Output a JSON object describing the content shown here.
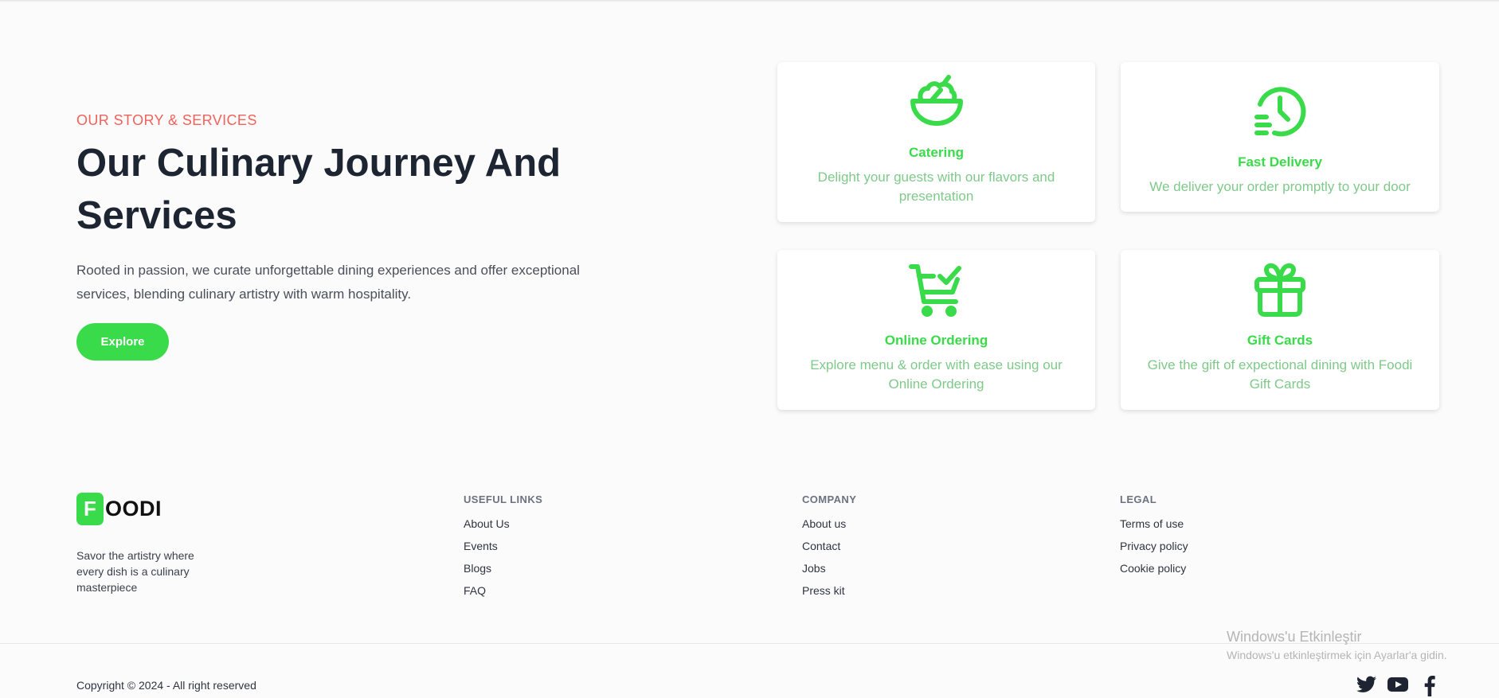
{
  "hero": {
    "eyebrow": "OUR STORY & SERVICES",
    "title": "Our Culinary Journey And Services",
    "description": "Rooted in passion, we curate unforgettable dining experiences and offer exceptional services, blending culinary artistry with warm hospitality.",
    "cta_label": "Explore"
  },
  "services": [
    {
      "icon": "salad-bowl-icon",
      "title": "Catering",
      "description": "Delight your guests with our flavors and presentation"
    },
    {
      "icon": "fast-delivery-clock-icon",
      "title": "Fast Delivery",
      "description": "We deliver your order promptly to your door"
    },
    {
      "icon": "shopping-cart-check-icon",
      "title": "Online Ordering",
      "description": "Explore menu & order with ease using our Online Ordering"
    },
    {
      "icon": "gift-icon",
      "title": "Gift Cards",
      "description": "Give the gift of expectional dining with Foodi Gift Cards"
    }
  ],
  "footer": {
    "logo_letter": "F",
    "logo_text": "OODI",
    "tagline": "Savor the artistry where every dish is a culinary masterpiece",
    "columns": [
      {
        "heading": "USEFUL LINKS",
        "links": [
          "About Us",
          "Events",
          "Blogs",
          "FAQ"
        ]
      },
      {
        "heading": "COMPANY",
        "links": [
          "About us",
          "Contact",
          "Jobs",
          "Press kit"
        ]
      },
      {
        "heading": "LEGAL",
        "links": [
          "Terms of use",
          "Privacy policy",
          "Cookie policy"
        ]
      }
    ],
    "copyright": "Copyright © 2024 - All right reserved",
    "social": [
      "twitter-icon",
      "youtube-icon",
      "facebook-icon"
    ]
  },
  "watermark": {
    "title": "Windows'u Etkinleştir",
    "subtitle": "Windows'u etkinleştirmek için Ayarlar'a gidin."
  },
  "colors": {
    "accent": "#39db4a",
    "eyebrow": "#f0625b",
    "heading": "#1d2432",
    "card_text": "#7fc98a"
  }
}
